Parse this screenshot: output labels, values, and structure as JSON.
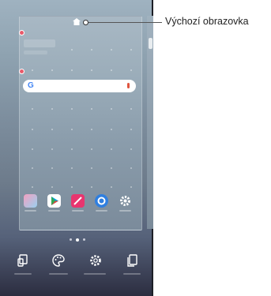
{
  "callout": {
    "label": "Výchozí obrazovka"
  },
  "search_bar": {
    "logo": "G",
    "icons": [
      "google-logo-icon",
      "microphone-icon"
    ]
  },
  "page_indicator": {
    "pages": 3,
    "active_index": 1
  },
  "dock_apps": [
    "gallery-app-icon",
    "play-store-icon",
    "qnote-icon",
    "browser-icon",
    "settings-icon"
  ],
  "edit_toolbar": [
    "widgets-icon",
    "themes-icon",
    "home-settings-icon",
    "pages-icon"
  ],
  "colors": {
    "accent_red": "#e85a6a",
    "google_blue": "#4285f4",
    "mic_red": "#e0553f"
  }
}
